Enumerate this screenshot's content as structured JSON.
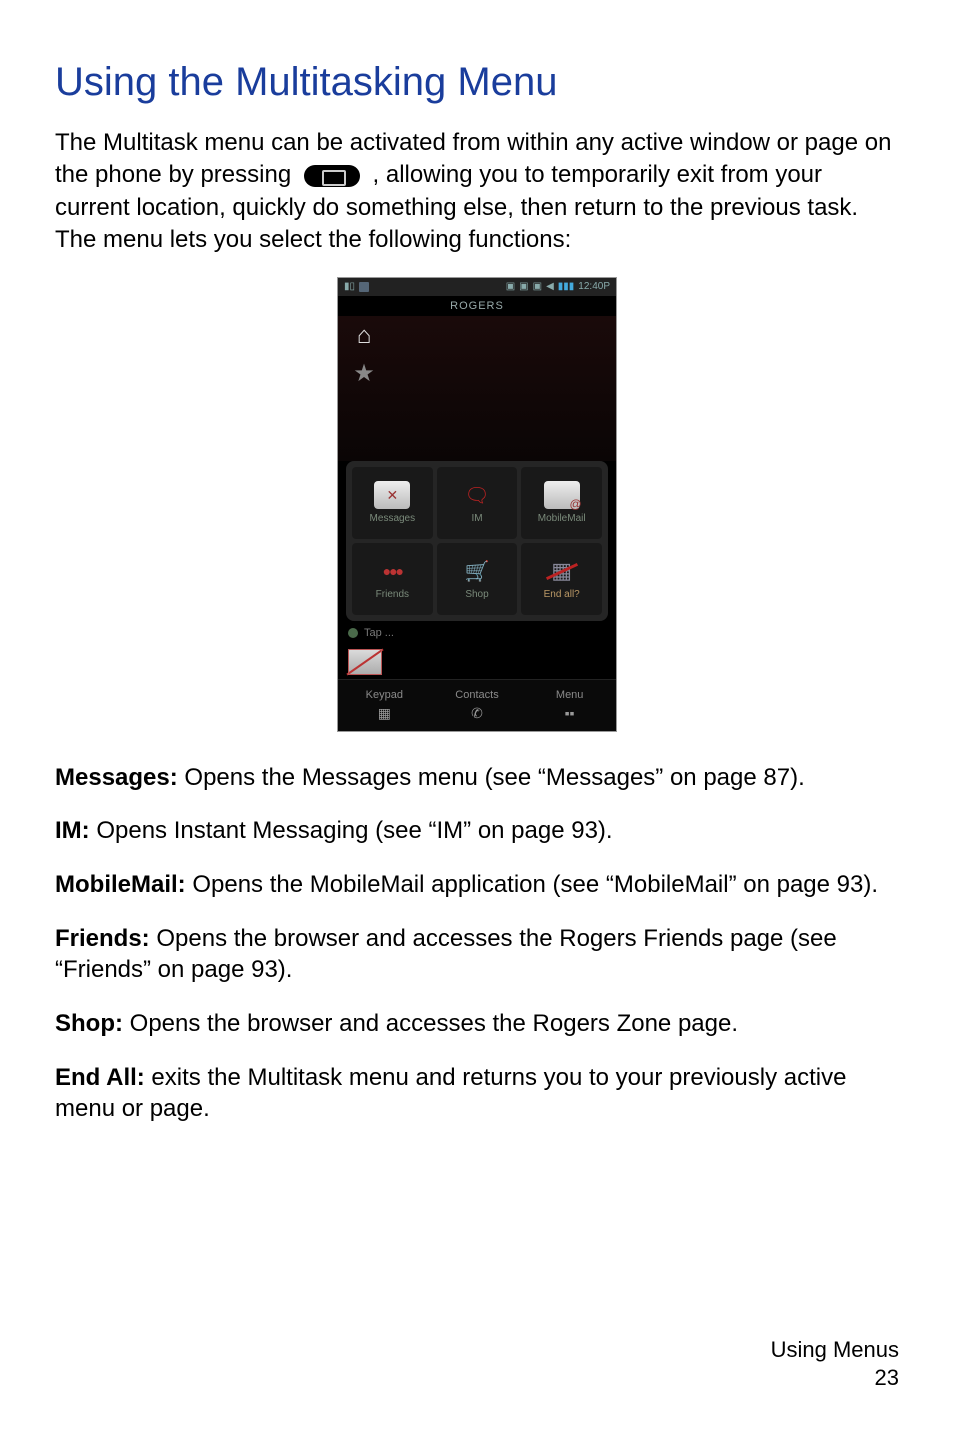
{
  "heading": "Using the Multitasking Menu",
  "intro_before_key": "The Multitask menu can be activated from within any active window or page on the phone by pressing ",
  "intro_after_key": ", allowing you to temporarily exit from your current location, quickly do something else, then return to the previous task. The menu lets you select the following functions:",
  "phone": {
    "time": "12:40P",
    "carrier": "ROGERS",
    "grid": {
      "messages": "Messages",
      "im": "IM",
      "mobilemail": "MobileMail",
      "friends": "Friends",
      "shop": "Shop",
      "end_all": "End all?"
    },
    "tap": "Tap ...",
    "softkeys": {
      "keypad": "Keypad",
      "contacts": "Contacts",
      "menu": "Menu"
    }
  },
  "defs": {
    "messages": {
      "label": "Messages:",
      "text": " Opens the Messages menu (see “Messages” on page 87)."
    },
    "im": {
      "label": "IM:",
      "text": " Opens Instant Messaging (see “IM” on page 93)."
    },
    "mobilemail": {
      "label": "MobileMail:",
      "text": " Opens the MobileMail application (see “MobileMail” on page 93)."
    },
    "friends": {
      "label": "Friends:",
      "text": " Opens the browser and accesses the Rogers Friends page (see “Friends” on page 93)."
    },
    "shop": {
      "label": "Shop:",
      "text": " Opens the browser and accesses the Rogers Zone page."
    },
    "end_all": {
      "label": "End All:",
      "text": " exits the Multitask menu and returns you to your previously active menu or page."
    }
  },
  "footer": {
    "section": "Using Menus",
    "page": "23"
  }
}
